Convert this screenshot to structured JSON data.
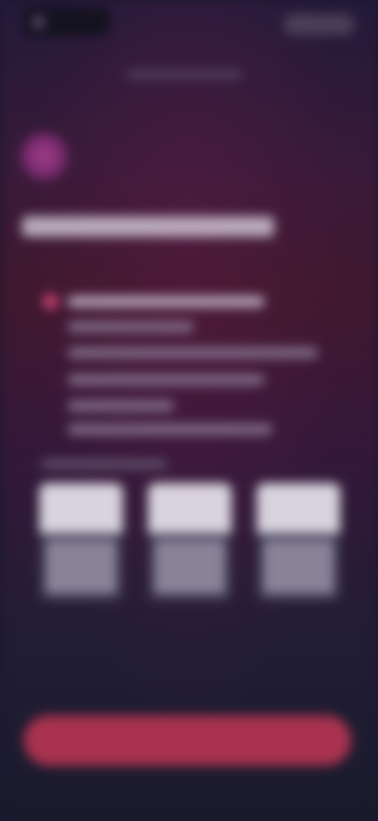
{
  "header": {
    "logo_icon": "app-logo-icon",
    "top_button_label": ""
  },
  "onboarding": {
    "subtitle": "",
    "hero_icon": "brand-orb-icon",
    "headline": "",
    "checklist_icon": "check-icon",
    "description_lines": [
      "",
      "",
      "",
      "",
      "",
      ""
    ],
    "caption": ""
  },
  "preview_cards": [
    {
      "label": ""
    },
    {
      "label": ""
    },
    {
      "label": ""
    }
  ],
  "primary_action": {
    "label": ""
  },
  "colors": {
    "accent": "#a8324f",
    "check": "#c2416e",
    "orb": "#7a2a6e",
    "background_top": "#231a3a",
    "background_bottom": "#1a1a2c"
  }
}
